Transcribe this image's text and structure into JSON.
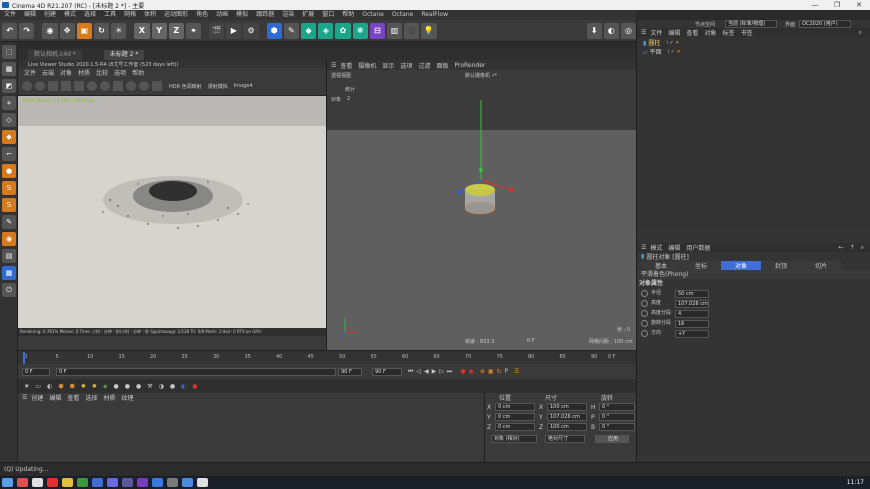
{
  "window": {
    "title": "Cinema 4D R21.207 (RC) - [未标题 2 *] - 主要",
    "controls": [
      "—",
      "❐",
      "✕"
    ]
  },
  "menu": [
    "文件",
    "编辑",
    "创建",
    "模式",
    "选择",
    "工具",
    "网格",
    "体积",
    "运动图形",
    "角色",
    "动画",
    "模拟",
    "跟踪器",
    "渲染",
    "扩展",
    "窗口",
    "帮助",
    "Octane",
    "Octane",
    "RealFlow"
  ],
  "layout": {
    "label": "界面",
    "value": "OC2020 (用户)",
    "node_space_label": "节点空间",
    "node_space_value": "当前 (标准/物理)"
  },
  "toolbar": {
    "axis_x": "X",
    "axis_y": "Y",
    "axis_z": "Z"
  },
  "doc_tabs": {
    "left": "默认相机.c4d *",
    "right": "未标题 2 *"
  },
  "live_viewer": {
    "title": "Live Viewer Studio 2020.1.5-R4 (8尤号工作室 (523 days left))",
    "menu": [
      "文件",
      "云端",
      "对象",
      "材质",
      "比较",
      "选项",
      "帮助"
    ],
    "hdr_label": "HDR 色调映射",
    "mode_label": "漫射模拟",
    "image_label": "Image4",
    "status_overlay": "3590 Nodes 15 (0) Updating...",
    "footer": "Rendering: 0.781%   Ms/sec: 0   Time: 小时 : 分钟 : 秒/小时 : 分钟 : 秒   Spp/maxspp: 1/128   Tri: 0/8   Mesh: 2   Hair: 0   RTX:on   GPU: "
  },
  "viewport": {
    "menu": [
      "查看",
      "摄像机",
      "显示",
      "选项",
      "过滤",
      "面板",
      "ProRender"
    ],
    "view_label": "透视视图",
    "camera_label": "默认摄像机 •*",
    "overlay_title": "统计",
    "overlay_key": "对象",
    "overlay_value": "2",
    "fps_label": "帧速 : 833.3",
    "grid_label": "网格间距 : 100 cm",
    "frame_label": "0 F",
    "axis_label": "帧 : 0"
  },
  "timeline": {
    "ticks": [
      "0",
      "5",
      "10",
      "15",
      "20",
      "25",
      "30",
      "35",
      "40",
      "45",
      "50",
      "55",
      "60",
      "65",
      "70",
      "75",
      "80",
      "85",
      "90"
    ],
    "end_frame": "0 F",
    "start_field": "0 F",
    "current_field": "0 F",
    "max_field": "90 F",
    "end_field": "90 F"
  },
  "material_manager": {
    "menu": [
      "创建",
      "编辑",
      "查看",
      "选择",
      "材质",
      "纹理"
    ]
  },
  "coordinates": {
    "headers": [
      "位置",
      "尺寸",
      "旋转"
    ],
    "rows": [
      {
        "axis": "X",
        "pos": "0 cm",
        "size_axis": "X",
        "size": "100 cm",
        "rot_axis": "H",
        "rot": "0 °"
      },
      {
        "axis": "Y",
        "pos": "0 cm",
        "size_axis": "Y",
        "size": "107.026 cm",
        "rot_axis": "P",
        "rot": "0 °"
      },
      {
        "axis": "Z",
        "pos": "0 cm",
        "size_axis": "Z",
        "size": "100 cm",
        "rot_axis": "B",
        "rot": "0 °"
      }
    ],
    "mode1": "对象 (相对)",
    "mode2": "绝对尺寸",
    "apply": "应用"
  },
  "object_manager": {
    "menu": [
      "文件",
      "编辑",
      "查看",
      "对象",
      "标签",
      "书签"
    ],
    "items": [
      "圆柱",
      "平面"
    ]
  },
  "attributes": {
    "menu": [
      "模式",
      "编辑",
      "用户数据"
    ],
    "object_title": "圆柱对象 [圆柱]",
    "tabs": [
      "基本",
      "坐标",
      "对象",
      "封顶",
      "切片"
    ],
    "active_tab": 2,
    "shading": "平滑着色(Phong)",
    "section": "对象属性",
    "props": [
      {
        "label": "半径",
        "value": "50 cm"
      },
      {
        "label": "高度",
        "value": "107.026 cm"
      },
      {
        "label": "高度分段",
        "value": "4"
      },
      {
        "label": "旋转分段",
        "value": "16"
      },
      {
        "label": "方向",
        "value": "+Y"
      }
    ]
  },
  "status_bar": "(Q) Updating...",
  "taskbar": {
    "time": "11:17"
  },
  "colors": {
    "accent": "#3f6fd6",
    "orange": "#e0862a",
    "teal": "#1aa68a",
    "bg": "#2b2b2b"
  }
}
